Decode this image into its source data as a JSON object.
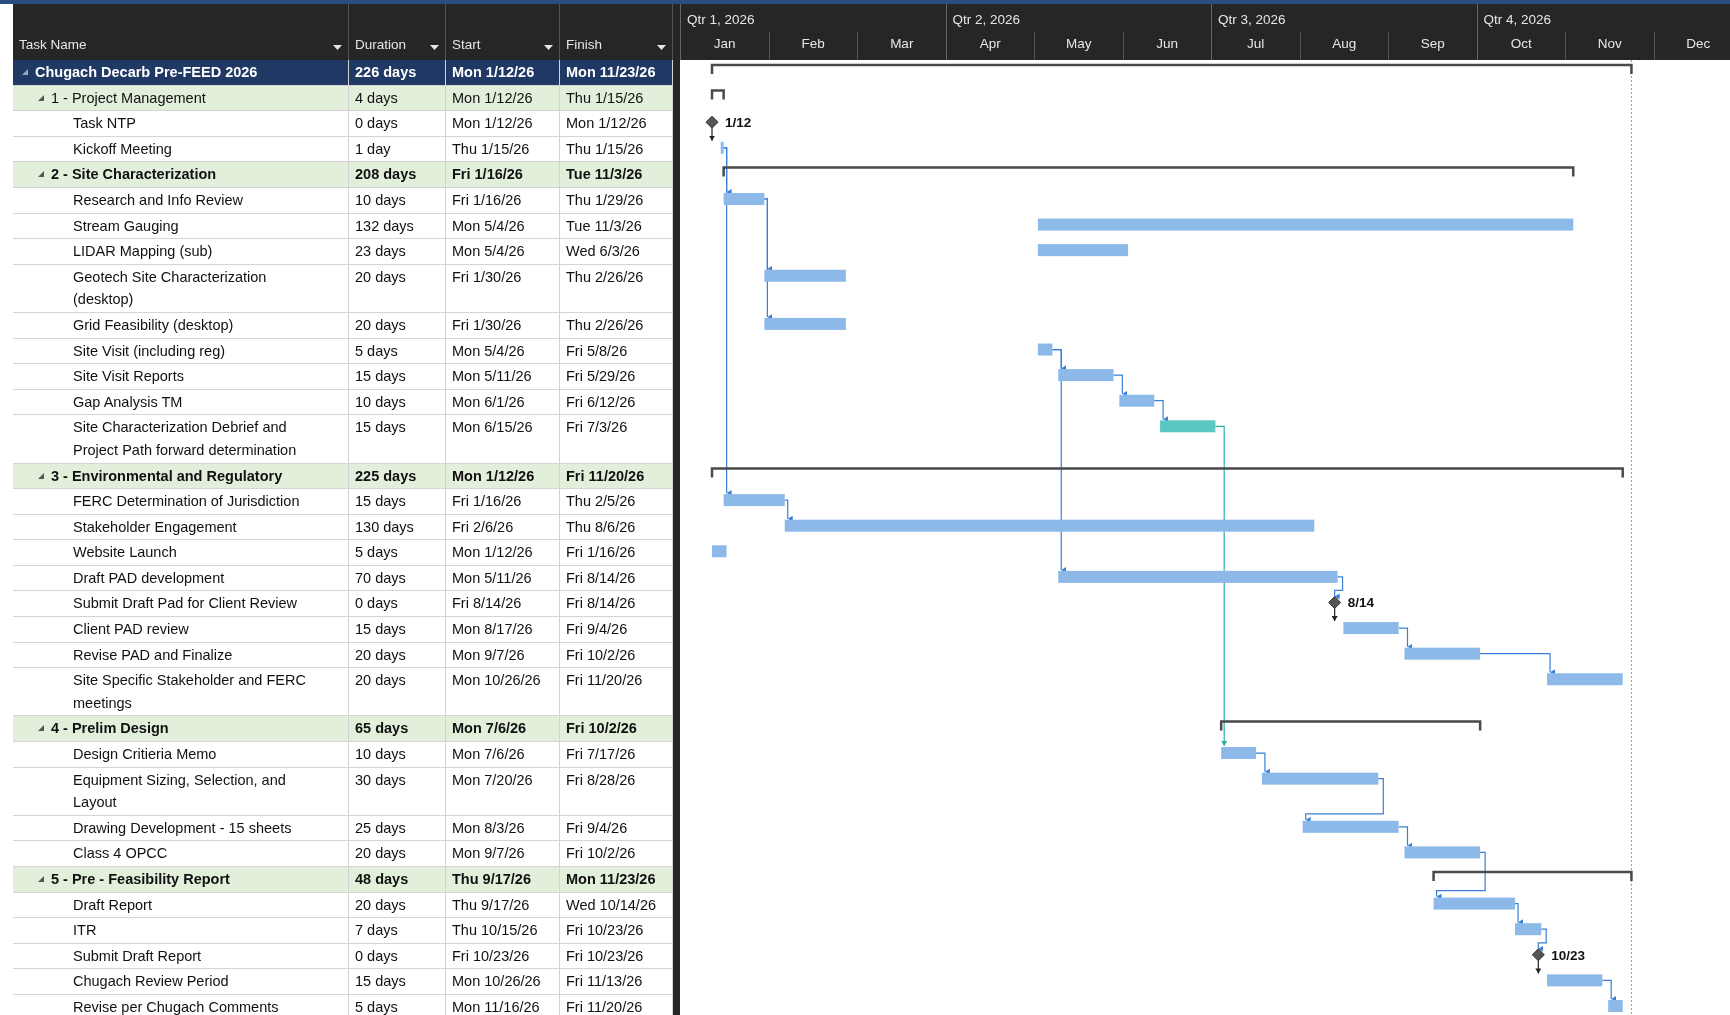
{
  "columns": [
    {
      "label": "Task Name"
    },
    {
      "label": "Duration"
    },
    {
      "label": "Start"
    },
    {
      "label": "Finish"
    }
  ],
  "timeline": {
    "quarters": [
      "Qtr 1, 2026",
      "Qtr 2, 2026",
      "Qtr 3, 2026",
      "Qtr 4, 2026"
    ],
    "months": [
      "Jan",
      "Feb",
      "Mar",
      "Apr",
      "May",
      "Jun",
      "Jul",
      "Aug",
      "Sep",
      "Oct",
      "Nov",
      "Dec"
    ]
  },
  "rows": [
    {
      "kind": "project",
      "name": "Chugach Decarb Pre-FEED 2026",
      "duration": "226 days",
      "start": "Mon 1/12/26",
      "finish": "Mon 11/23/26",
      "expanded": true
    },
    {
      "kind": "summary",
      "name": "1 - Project Management",
      "duration": "4 days",
      "start": "Mon 1/12/26",
      "finish": "Thu 1/15/26",
      "expanded": true,
      "bold": false
    },
    {
      "kind": "milestone",
      "name": "Task NTP",
      "duration": "0 days",
      "start": "Mon 1/12/26",
      "finish": "Mon 1/12/26",
      "label": "1/12"
    },
    {
      "kind": "task",
      "name": "Kickoff Meeting",
      "duration": "1 day",
      "start": "Thu 1/15/26",
      "finish": "Thu 1/15/26",
      "color": "#8cb9e8"
    },
    {
      "kind": "summary",
      "name": "2 - Site Characterization",
      "duration": "208 days",
      "start": "Fri 1/16/26",
      "finish": "Tue 11/3/26",
      "expanded": true,
      "bold": true
    },
    {
      "kind": "task",
      "name": "Research and Info Review",
      "duration": "10 days",
      "start": "Fri 1/16/26",
      "finish": "Thu 1/29/26",
      "color": "#8cb9e8"
    },
    {
      "kind": "task",
      "name": "Stream Gauging",
      "duration": "132 days",
      "start": "Mon 5/4/26",
      "finish": "Tue 11/3/26",
      "color": "#8cb9e8"
    },
    {
      "kind": "task",
      "name": "LIDAR Mapping (sub)",
      "duration": "23 days",
      "start": "Mon 5/4/26",
      "finish": "Wed 6/3/26",
      "color": "#8cb9e8"
    },
    {
      "kind": "task",
      "name": "Geotech Site Characterization (desktop)",
      "duration": "20 days",
      "start": "Fri 1/30/26",
      "finish": "Thu 2/26/26",
      "color": "#8cb9e8"
    },
    {
      "kind": "task",
      "name": "Grid Feasibility (desktop)",
      "duration": "20 days",
      "start": "Fri 1/30/26",
      "finish": "Thu 2/26/26",
      "color": "#8cb9e8"
    },
    {
      "kind": "task",
      "name": "Site Visit (including reg)",
      "duration": "5 days",
      "start": "Mon 5/4/26",
      "finish": "Fri 5/8/26",
      "color": "#8cb9e8"
    },
    {
      "kind": "task",
      "name": "Site Visit Reports",
      "duration": "15 days",
      "start": "Mon 5/11/26",
      "finish": "Fri 5/29/26",
      "color": "#8cb9e8"
    },
    {
      "kind": "task",
      "name": "Gap Analysis TM",
      "duration": "10 days",
      "start": "Mon 6/1/26",
      "finish": "Fri 6/12/26",
      "color": "#8cb9e8"
    },
    {
      "kind": "task",
      "name": "Site Characterization Debrief and Project Path forward determination",
      "duration": "15 days",
      "start": "Mon 6/15/26",
      "finish": "Fri 7/3/26",
      "color": "#5cc6c2"
    },
    {
      "kind": "summary",
      "name": "3 - Environmental and Regulatory",
      "duration": "225 days",
      "start": "Mon 1/12/26",
      "finish": "Fri 11/20/26",
      "expanded": true,
      "bold": true
    },
    {
      "kind": "task",
      "name": "FERC Determination of Jurisdiction",
      "duration": "15 days",
      "start": "Fri 1/16/26",
      "finish": "Thu 2/5/26",
      "color": "#8cb9e8"
    },
    {
      "kind": "task",
      "name": "Stakeholder Engagement",
      "duration": "130 days",
      "start": "Fri 2/6/26",
      "finish": "Thu 8/6/26",
      "color": "#8cb9e8"
    },
    {
      "kind": "task",
      "name": "Website Launch",
      "duration": "5 days",
      "start": "Mon 1/12/26",
      "finish": "Fri 1/16/26",
      "color": "#8cb9e8"
    },
    {
      "kind": "task",
      "name": "Draft PAD development",
      "duration": "70 days",
      "start": "Mon 5/11/26",
      "finish": "Fri 8/14/26",
      "color": "#8cb9e8"
    },
    {
      "kind": "milestone",
      "name": "Submit Draft Pad for Client Review",
      "duration": "0 days",
      "start": "Fri 8/14/26",
      "finish": "Fri 8/14/26",
      "label": "8/14"
    },
    {
      "kind": "task",
      "name": "Client PAD review",
      "duration": "15 days",
      "start": "Mon 8/17/26",
      "finish": "Fri 9/4/26",
      "color": "#8cb9e8"
    },
    {
      "kind": "task",
      "name": "Revise PAD and Finalize",
      "duration": "20 days",
      "start": "Mon 9/7/26",
      "finish": "Fri 10/2/26",
      "color": "#8cb9e8"
    },
    {
      "kind": "task",
      "name": "Site Specific Stakeholder and FERC meetings",
      "duration": "20 days",
      "start": "Mon 10/26/26",
      "finish": "Fri 11/20/26",
      "color": "#8cb9e8"
    },
    {
      "kind": "summary",
      "name": "4 - Prelim Design",
      "duration": "65 days",
      "start": "Mon 7/6/26",
      "finish": "Fri 10/2/26",
      "expanded": true,
      "bold": true
    },
    {
      "kind": "task",
      "name": "Design Critieria Memo",
      "duration": "10 days",
      "start": "Mon 7/6/26",
      "finish": "Fri 7/17/26",
      "color": "#8cb9e8"
    },
    {
      "kind": "task",
      "name": "Equipment Sizing, Selection, and Layout",
      "duration": "30 days",
      "start": "Mon 7/20/26",
      "finish": "Fri 8/28/26",
      "color": "#8cb9e8"
    },
    {
      "kind": "task",
      "name": "Drawing Development - 15 sheets",
      "duration": "25 days",
      "start": "Mon 8/3/26",
      "finish": "Fri 9/4/26",
      "color": "#8cb9e8"
    },
    {
      "kind": "task",
      "name": "Class 4 OPCC",
      "duration": "20 days",
      "start": "Mon 9/7/26",
      "finish": "Fri 10/2/26",
      "color": "#8cb9e8"
    },
    {
      "kind": "summary",
      "name": "5 - Pre - Feasibility Report",
      "duration": "48 days",
      "start": "Thu 9/17/26",
      "finish": "Mon 11/23/26",
      "expanded": true,
      "bold": true
    },
    {
      "kind": "task",
      "name": "Draft Report",
      "duration": "20 days",
      "start": "Thu 9/17/26",
      "finish": "Wed 10/14/26",
      "color": "#8cb9e8"
    },
    {
      "kind": "task",
      "name": "ITR",
      "duration": "7 days",
      "start": "Thu 10/15/26",
      "finish": "Fri 10/23/26",
      "color": "#8cb9e8"
    },
    {
      "kind": "milestone",
      "name": "Submit Draft Report",
      "duration": "0 days",
      "start": "Fri 10/23/26",
      "finish": "Fri 10/23/26",
      "label": "10/23"
    },
    {
      "kind": "task",
      "name": "Chugach Review Period",
      "duration": "15 days",
      "start": "Mon 10/26/26",
      "finish": "Fri 11/13/26",
      "color": "#8cb9e8"
    },
    {
      "kind": "task",
      "name": "Revise per Chugach Comments",
      "duration": "5 days",
      "start": "Mon 11/16/26",
      "finish": "Fri 11/20/26",
      "color": "#8cb9e8"
    }
  ]
}
